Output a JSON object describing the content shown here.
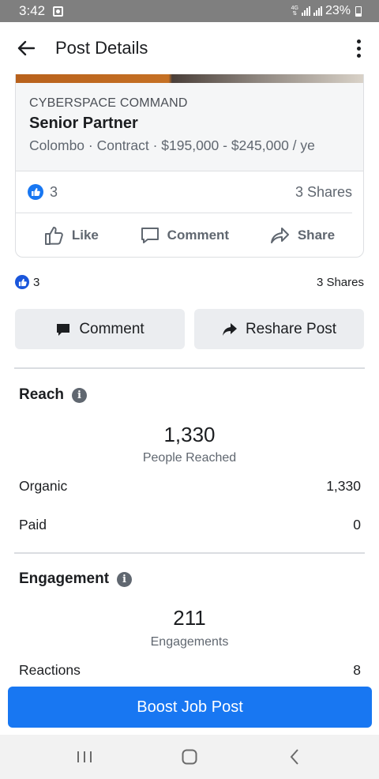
{
  "status_bar": {
    "time": "3:42",
    "network": "4G",
    "battery": "23%"
  },
  "header": {
    "title": "Post Details"
  },
  "job_card": {
    "company": "CYBERSPACE COMMAND",
    "title": "Senior Partner",
    "meta": "Colombo · Contract · $195,000 - $245,000 / ye",
    "likes": "3",
    "shares": "3 Shares",
    "actions": {
      "like": "Like",
      "comment": "Comment",
      "share": "Share"
    }
  },
  "post_stats": {
    "likes": "3",
    "shares": "3 Shares"
  },
  "buttons": {
    "comment": "Comment",
    "reshare": "Reshare Post"
  },
  "reach": {
    "title": "Reach",
    "total": "1,330",
    "caption": "People Reached",
    "rows": [
      {
        "label": "Organic",
        "value": "1,330"
      },
      {
        "label": "Paid",
        "value": "0"
      }
    ]
  },
  "engagement": {
    "title": "Engagement",
    "total": "211",
    "caption": "Engagements",
    "rows": [
      {
        "label": "Reactions",
        "value": "8"
      }
    ]
  },
  "boost": {
    "label": "Boost Job Post"
  },
  "icons": {
    "back": "arrow-left-icon",
    "more": "more-vertical-icon",
    "info": "info-icon"
  },
  "colors": {
    "accent": "#1877f2",
    "status_bar": "#7f7f7f"
  }
}
